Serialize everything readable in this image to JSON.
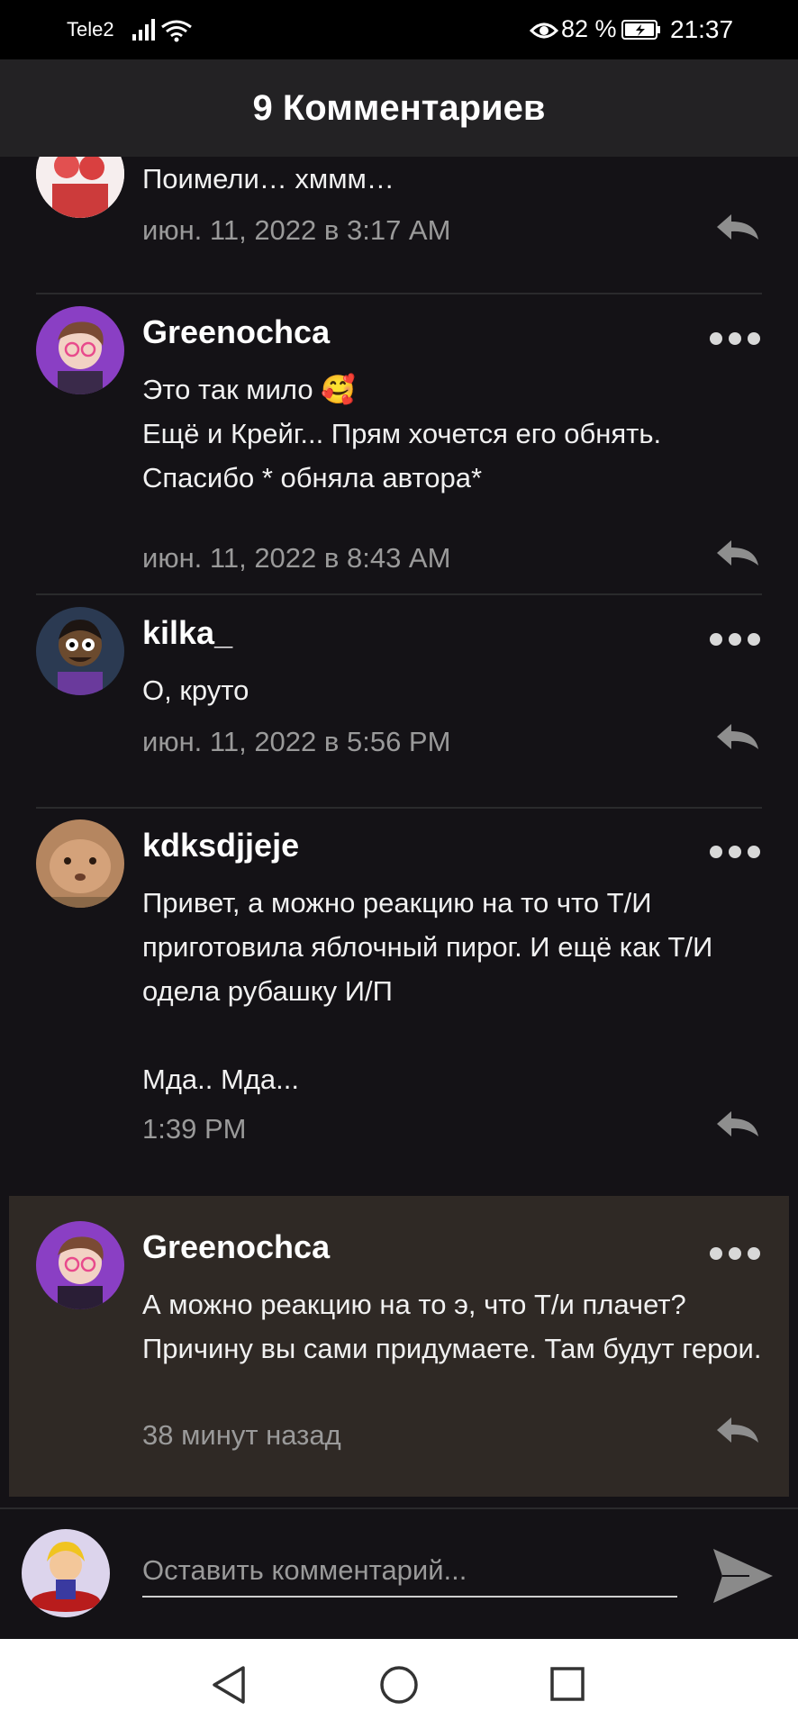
{
  "status_bar": {
    "carrier": "Tele2",
    "battery_percent": "82 %",
    "time": "21:37"
  },
  "header": {
    "title": "9 Комментариев"
  },
  "comments": [
    {
      "username": "",
      "text": "Поимели… хммм…",
      "time": "июн. 11, 2022 в 3:17 AM"
    },
    {
      "username": "Greenochca",
      "text": "Это так мило 🥰\nЕщё и Крейг... Прям хочется его обнять.\nСпасибо * обняла автора*",
      "time": "июн. 11, 2022 в 8:43 AM"
    },
    {
      "username": "kilka_",
      "text": "О, круто",
      "time": "июн. 11, 2022 в 5:56 PM"
    },
    {
      "username": "kdksdjjeje",
      "text": "Привет, а можно реакцию на то что Т/И приготовила яблочный пирог. И ещё как Т/И одела рубашку И/П\n\nМда.. Мда...",
      "time": "1:39 PM"
    },
    {
      "username": "Greenochca",
      "text": "А можно реакцию на то э, что Т/и плачет? Причину вы сами придумаете. Там будут герои.",
      "time": "38 минут назад"
    }
  ],
  "compose": {
    "placeholder": "Оставить комментарий..."
  },
  "colors": {
    "background": "#141216",
    "header": "#232224",
    "highlight": "#2f2925",
    "timestamp": "#9a9a9a"
  },
  "icons": [
    "signal-icon",
    "wifi-icon",
    "eye-icon",
    "battery-icon",
    "more-icon",
    "reply-icon",
    "send-icon",
    "nav-back-icon",
    "nav-home-icon",
    "nav-recent-icon"
  ]
}
